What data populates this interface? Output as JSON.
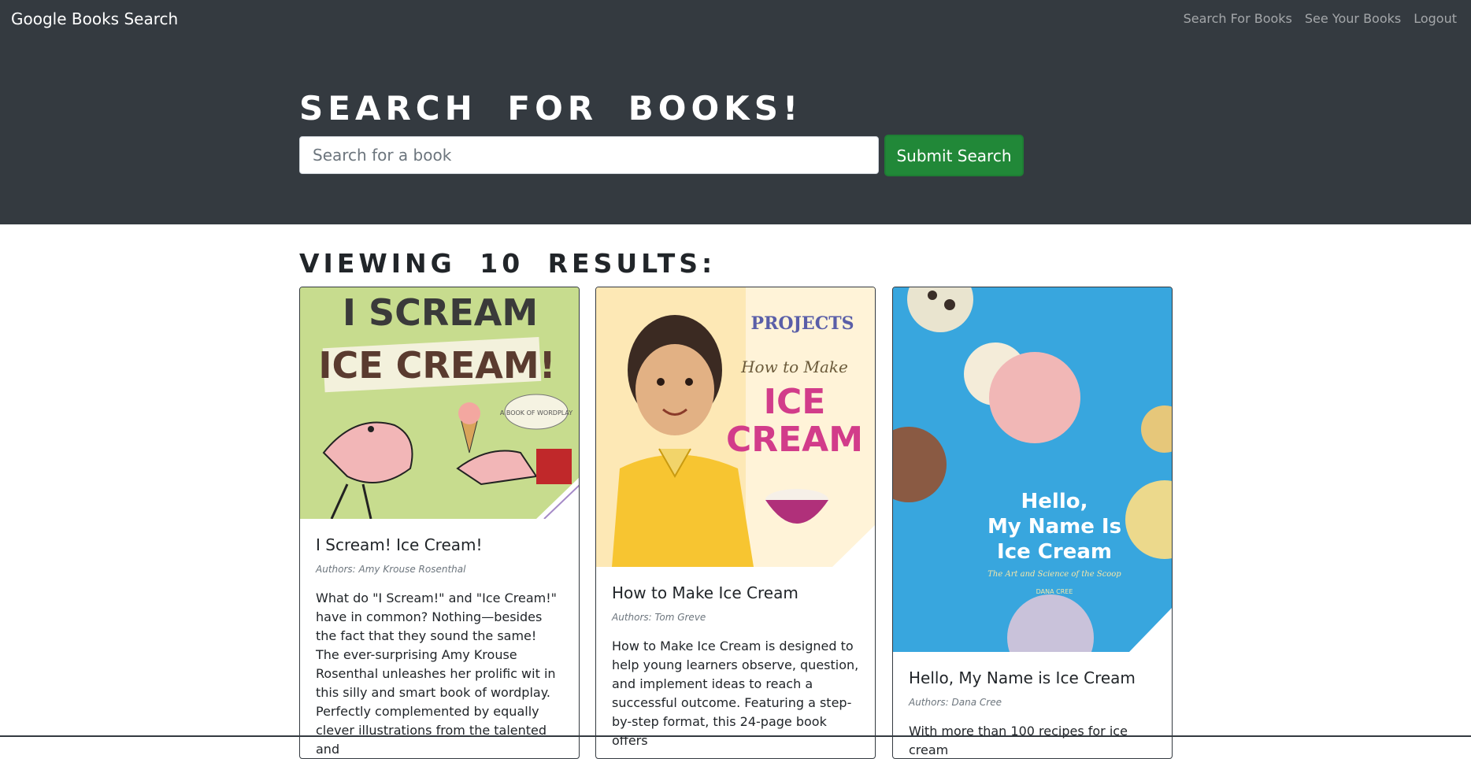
{
  "nav": {
    "brand": "Google Books Search",
    "links": [
      "Search For Books",
      "See Your Books",
      "Logout"
    ]
  },
  "hero": {
    "title": "Search for Books!",
    "search_placeholder": "Search for a book",
    "submit_label": "Submit Search"
  },
  "results": {
    "heading": "Viewing 10 results:",
    "books": [
      {
        "title": "I Scream! Ice Cream!",
        "authors": "Authors: Amy Krouse Rosenthal",
        "description": "What do \"I Scream!\" and \"Ice Cream!\" have in common? Nothing—besides the fact that they sound the same! The ever-surprising Amy Krouse Rosenthal unleashes her prolific wit in this silly and smart book of wordplay. Perfectly complemented by equally clever illustrations from the talented and",
        "cover": {
          "line1": "I SCREAM",
          "line2": "ICE CREAM!",
          "badge": "A BOOK OF WORDPLAY"
        }
      },
      {
        "title": "How to Make Ice Cream",
        "authors": "Authors: Tom Greve",
        "description": "How to Make Ice Cream is designed to help young learners observe, question, and implement ideas to reach a successful outcome. Featuring a step-by-step format, this 24-page book offers",
        "cover": {
          "series": "PROJECTS",
          "line1": "How to Make",
          "line2": "ICE",
          "line3": "CREAM"
        }
      },
      {
        "title": "Hello, My Name is Ice Cream",
        "authors": "Authors: Dana Cree",
        "description": "With more than 100 recipes for ice cream",
        "cover": {
          "line1": "Hello,",
          "line2": "My Name Is",
          "line3": "Ice Cream",
          "subtitle": "The Art and Science of the Scoop",
          "author": "DANA CREE"
        }
      }
    ]
  },
  "colors": {
    "navbar": "#343a40",
    "submit": "#218838",
    "card_border": "#343a40"
  }
}
